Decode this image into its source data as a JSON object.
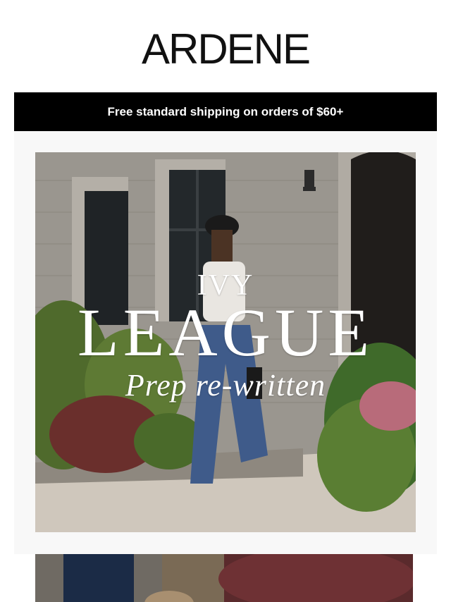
{
  "brand": {
    "logo_text": "ARDENE"
  },
  "promo_bar": {
    "text": "Free standard shipping on orders of $60+"
  },
  "hero": {
    "overlay_line1": "IVY",
    "overlay_line2": "LEAGUE",
    "overlay_line3": "Prep re-written"
  },
  "colors": {
    "promo_bg": "#000000",
    "promo_text": "#ffffff",
    "hero_frame_bg": "#f8f8f8",
    "page_bg": "#ffffff"
  }
}
